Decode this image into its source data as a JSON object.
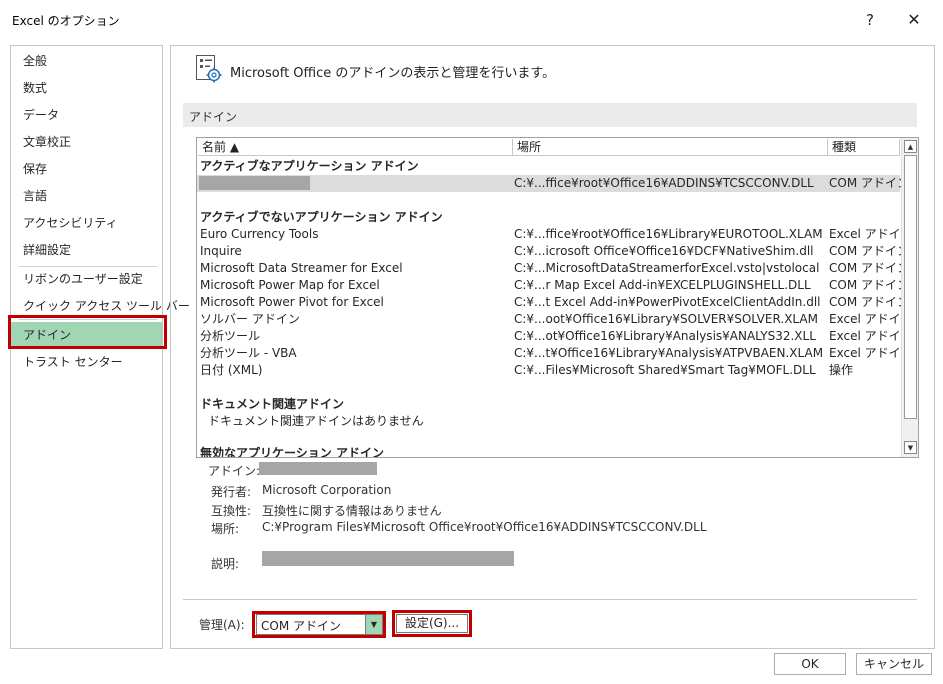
{
  "window": {
    "title": "Excel のオプション",
    "help_glyph": "?",
    "close_glyph": "✕"
  },
  "sidebar": {
    "items": [
      {
        "label": "全般"
      },
      {
        "label": "数式"
      },
      {
        "label": "データ"
      },
      {
        "label": "文章校正"
      },
      {
        "label": "保存"
      },
      {
        "label": "言語"
      },
      {
        "label": "アクセシビリティ"
      },
      {
        "label": "詳細設定"
      },
      {
        "label": "リボンのユーザー設定"
      },
      {
        "label": "クイック アクセス ツール バー"
      },
      {
        "label": "アドイン"
      },
      {
        "label": "トラスト センター"
      }
    ],
    "selected": "アドイン"
  },
  "header": {
    "icon": "addin-gear-icon",
    "text": "Microsoft Office のアドインの表示と管理を行います。"
  },
  "section_title": "アドイン",
  "list": {
    "columns": [
      "名前 ▲",
      "場所",
      "種類"
    ],
    "groups": {
      "active": "アクティブなアプリケーション アドイン",
      "inactive": "アクティブでないアプリケーション アドイン",
      "document": "ドキュメント関連アドイン",
      "disabled": "無効なアプリケーション アドイン"
    },
    "active_rows": [
      {
        "name": "",
        "location": "C:¥...ffice¥root¥Office16¥ADDINS¥TCSCCONV.DLL",
        "type": "COM アドイン"
      }
    ],
    "inactive_rows": [
      {
        "name": "Euro Currency Tools",
        "location": "C:¥...ffice¥root¥Office16¥Library¥EUROTOOL.XLAM",
        "type": "Excel アドイン"
      },
      {
        "name": "Inquire",
        "location": "C:¥...icrosoft Office¥Office16¥DCF¥NativeShim.dll",
        "type": "COM アドイン"
      },
      {
        "name": "Microsoft Data Streamer for Excel",
        "location": "C:¥...MicrosoftDataStreamerforExcel.vsto|vstolocal",
        "type": "COM アドイン"
      },
      {
        "name": "Microsoft Power Map for Excel",
        "location": "C:¥...r Map Excel Add-in¥EXCELPLUGINSHELL.DLL",
        "type": "COM アドイン"
      },
      {
        "name": "Microsoft Power Pivot for Excel",
        "location": "C:¥...t Excel Add-in¥PowerPivotExcelClientAddIn.dll",
        "type": "COM アドイン"
      },
      {
        "name": "ソルバー アドイン",
        "location": "C:¥...oot¥Office16¥Library¥SOLVER¥SOLVER.XLAM",
        "type": "Excel アドイン"
      },
      {
        "name": "分析ツール",
        "location": "C:¥...ot¥Office16¥Library¥Analysis¥ANALYS32.XLL",
        "type": "Excel アドイン"
      },
      {
        "name": "分析ツール - VBA",
        "location": "C:¥...t¥Office16¥Library¥Analysis¥ATPVBAEN.XLAM",
        "type": "Excel アドイン"
      },
      {
        "name": "日付 (XML)",
        "location": "C:¥...Files¥Microsoft Shared¥Smart Tag¥MOFL.DLL",
        "type": "操作"
      }
    ],
    "document_empty": "ドキュメント関連アドインはありません"
  },
  "details": {
    "addin_label": "アドイン:",
    "publisher_label": "発行者:",
    "publisher_value": "Microsoft Corporation",
    "compat_label": "互換性:",
    "compat_value": "互換性に関する情報はありません",
    "location_label": "場所:",
    "location_value": "C:¥Program Files¥Microsoft Office¥root¥Office16¥ADDINS¥TCSCCONV.DLL",
    "description_label": "説明:"
  },
  "footer": {
    "manage_label": "管理(A):",
    "manage_value": "COM アドイン",
    "settings_label": "設定(G)...",
    "ok_label": "OK",
    "cancel_label": "キャンセル"
  },
  "colors": {
    "selection": "#a0d6b4",
    "highlight_border": "#c00000"
  }
}
